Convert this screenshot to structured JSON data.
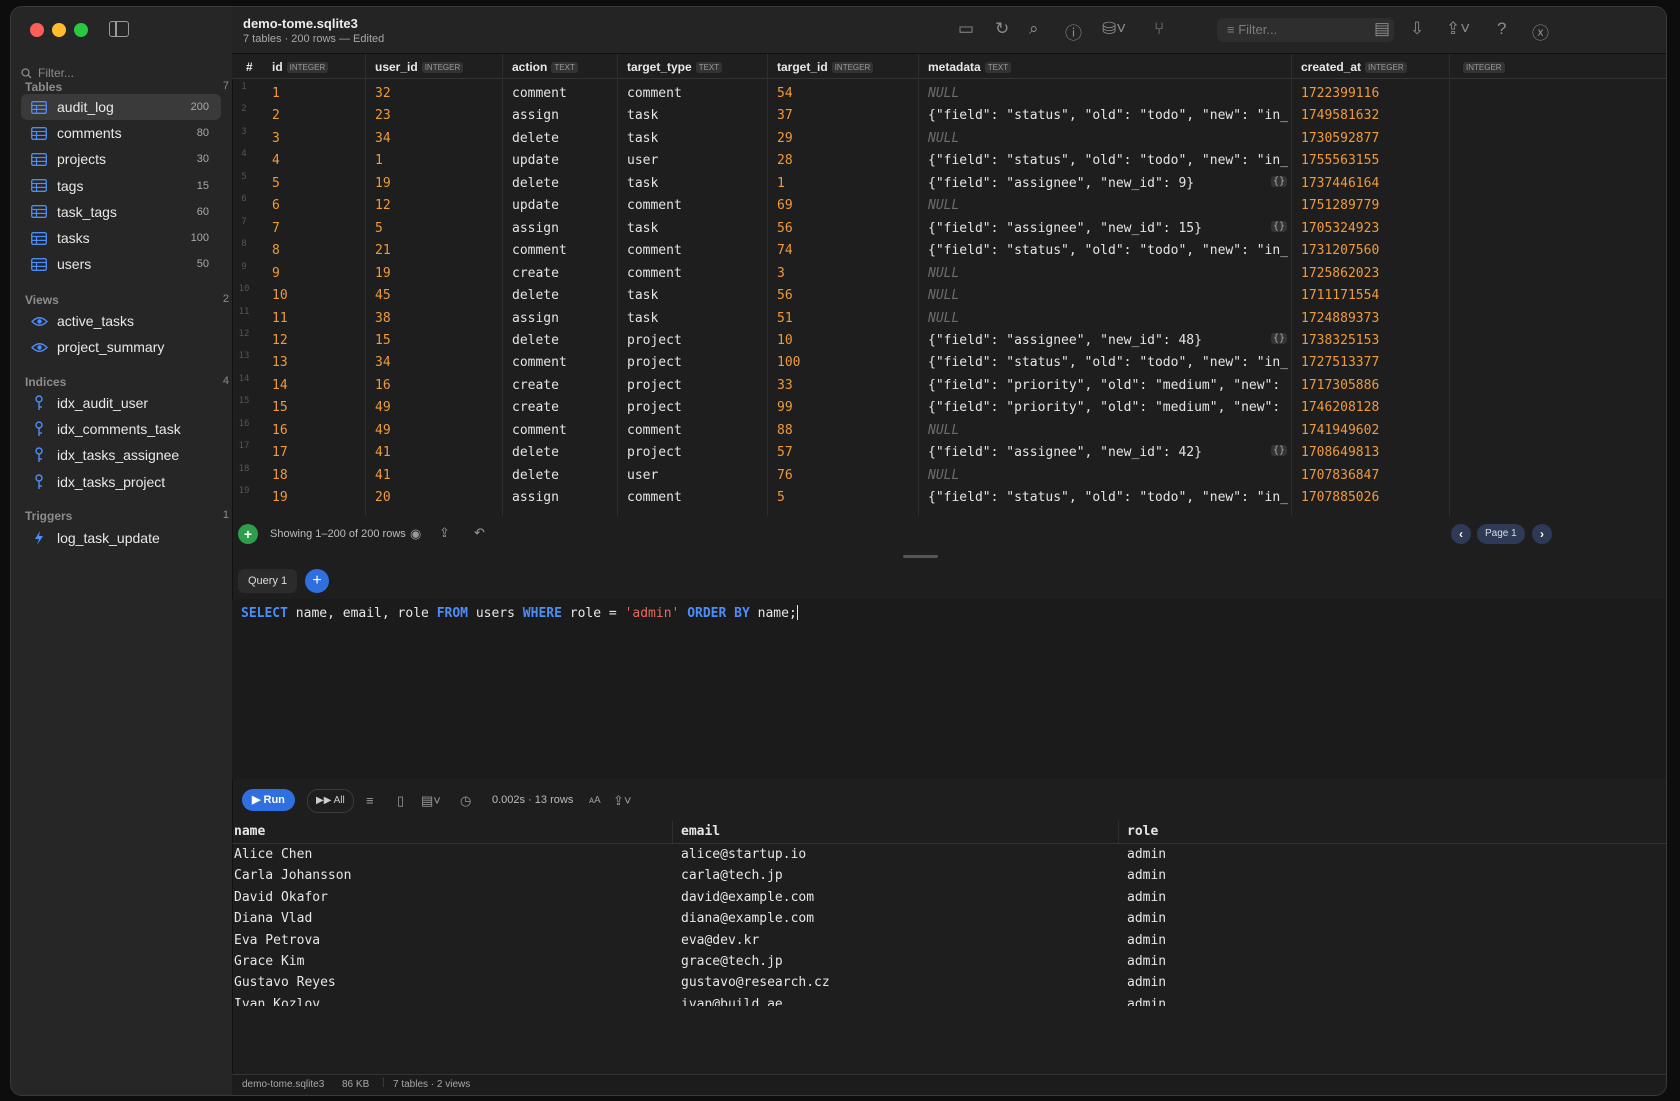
{
  "window": {
    "title": "demo-tome.sqlite3",
    "subtitle": "7 tables · 200 rows — Edited"
  },
  "sidebar": {
    "filter_placeholder": "Filter...",
    "tables_label": "Tables",
    "tables_count": "7",
    "tables": [
      {
        "name": "audit_log",
        "count": "200",
        "active": true
      },
      {
        "name": "comments",
        "count": "80"
      },
      {
        "name": "projects",
        "count": "30"
      },
      {
        "name": "tags",
        "count": "15"
      },
      {
        "name": "task_tags",
        "count": "60"
      },
      {
        "name": "tasks",
        "count": "100"
      },
      {
        "name": "users",
        "count": "50"
      }
    ],
    "views_label": "Views",
    "views_count": "2",
    "views": [
      "active_tasks",
      "project_summary"
    ],
    "indices_label": "Indices",
    "indices_count": "4",
    "indices": [
      "idx_audit_user",
      "idx_comments_task",
      "idx_tasks_assignee",
      "idx_tasks_project"
    ],
    "triggers_label": "Triggers",
    "triggers_count": "1",
    "triggers": [
      "log_task_update"
    ]
  },
  "toolbar": {
    "filter_placeholder": "Filter..."
  },
  "grid": {
    "rownum_header": "#",
    "columns": [
      {
        "name": "id",
        "type": "INTEGER"
      },
      {
        "name": "user_id",
        "type": "INTEGER"
      },
      {
        "name": "action",
        "type": "TEXT"
      },
      {
        "name": "target_type",
        "type": "TEXT"
      },
      {
        "name": "target_id",
        "type": "INTEGER"
      },
      {
        "name": "metadata",
        "type": "TEXT"
      },
      {
        "name": "created_at",
        "type": "INTEGER"
      },
      {
        "name": "",
        "type": "INTEGER"
      }
    ],
    "rows": [
      [
        "1",
        "32",
        "comment",
        "comment",
        "54",
        null,
        "1722399116"
      ],
      [
        "2",
        "23",
        "assign",
        "task",
        "37",
        "{\"field\": \"status\", \"old\": \"todo\", \"new\": \"in_p",
        "1749581632"
      ],
      [
        "3",
        "34",
        "delete",
        "task",
        "29",
        null,
        "1730592877"
      ],
      [
        "4",
        "1",
        "update",
        "user",
        "28",
        "{\"field\": \"status\", \"old\": \"todo\", \"new\": \"in_p",
        "1755563155"
      ],
      [
        "5",
        "19",
        "delete",
        "task",
        "1",
        "{\"field\": \"assignee\", \"new_id\": 9}",
        "1737446164"
      ],
      [
        "6",
        "12",
        "update",
        "comment",
        "69",
        null,
        "1751289779"
      ],
      [
        "7",
        "5",
        "assign",
        "task",
        "56",
        "{\"field\": \"assignee\", \"new_id\": 15}",
        "1705324923"
      ],
      [
        "8",
        "21",
        "comment",
        "comment",
        "74",
        "{\"field\": \"status\", \"old\": \"todo\", \"new\": \"in_p",
        "1731207560"
      ],
      [
        "9",
        "19",
        "create",
        "comment",
        "3",
        null,
        "1725862023"
      ],
      [
        "10",
        "45",
        "delete",
        "task",
        "56",
        null,
        "1711171554"
      ],
      [
        "11",
        "38",
        "assign",
        "task",
        "51",
        null,
        "1724889373"
      ],
      [
        "12",
        "15",
        "delete",
        "project",
        "10",
        "{\"field\": \"assignee\", \"new_id\": 48}",
        "1738325153"
      ],
      [
        "13",
        "34",
        "comment",
        "project",
        "100",
        "{\"field\": \"status\", \"old\": \"todo\", \"new\": \"in_p",
        "1727513377"
      ],
      [
        "14",
        "16",
        "create",
        "project",
        "33",
        "{\"field\": \"priority\", \"old\": \"medium\", \"new\": \"",
        "1717305886"
      ],
      [
        "15",
        "49",
        "create",
        "project",
        "99",
        "{\"field\": \"priority\", \"old\": \"medium\", \"new\": \"",
        "1746208128"
      ],
      [
        "16",
        "49",
        "comment",
        "comment",
        "88",
        null,
        "1741949602"
      ],
      [
        "17",
        "41",
        "delete",
        "project",
        "57",
        "{\"field\": \"assignee\", \"new_id\": 42}",
        "1708649813"
      ],
      [
        "18",
        "41",
        "delete",
        "user",
        "76",
        null,
        "1707836847"
      ],
      [
        "19",
        "20",
        "assign",
        "comment",
        "5",
        "{\"field\": \"status\", \"old\": \"todo\", \"new\": \"in_p",
        "1707885026"
      ]
    ],
    "null_label": "NULL",
    "footer_text": "Showing 1–200 of 200 rows",
    "page_label": "Page 1"
  },
  "query": {
    "tab_label": "Query 1",
    "sql_tokens": [
      {
        "t": "SELECT",
        "k": "kw"
      },
      {
        "t": " name, email, role ",
        "k": "plain"
      },
      {
        "t": "FROM",
        "k": "kw"
      },
      {
        "t": " users ",
        "k": "plain"
      },
      {
        "t": "WHERE",
        "k": "kw"
      },
      {
        "t": " role = ",
        "k": "plain"
      },
      {
        "t": "'admin'",
        "k": "str"
      },
      {
        "t": " ",
        "k": "plain"
      },
      {
        "t": "ORDER BY",
        "k": "kw"
      },
      {
        "t": " name;",
        "k": "plain"
      }
    ],
    "run_label": "Run",
    "all_label": "All",
    "timing": "0.002s · 13 rows"
  },
  "results": {
    "columns": [
      "name",
      "email",
      "role"
    ],
    "rows": [
      [
        "Alice Chen",
        "alice@startup.io",
        "admin"
      ],
      [
        "Carla Johansson",
        "carla@tech.jp",
        "admin"
      ],
      [
        "David Okafor",
        "david@example.com",
        "admin"
      ],
      [
        "Diana Vlad",
        "diana@example.com",
        "admin"
      ],
      [
        "Eva Petrova",
        "eva@dev.kr",
        "admin"
      ],
      [
        "Grace Kim",
        "grace@tech.jp",
        "admin"
      ],
      [
        "Gustavo Reyes",
        "gustavo@research.cz",
        "admin"
      ],
      [
        "Ivan Kozlov",
        "ivan@build.ae",
        "admin"
      ]
    ]
  },
  "status": {
    "file": "demo-tome.sqlite3",
    "size": "86 KB",
    "summary": "7 tables · 2 views"
  },
  "colors": {
    "accent": "#2f6fe0",
    "number": "#ef9a3c",
    "keyword": "#4d8df7",
    "string": "#e76b5c"
  }
}
